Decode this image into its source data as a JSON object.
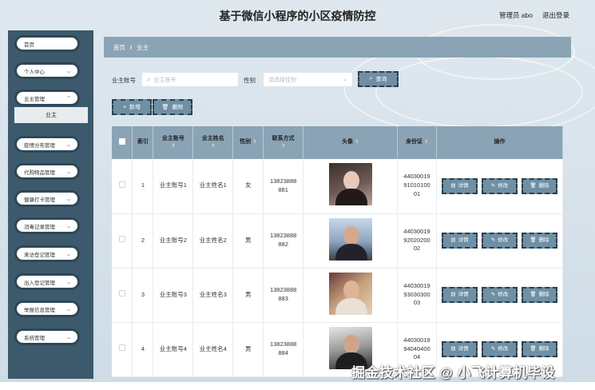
{
  "header": {
    "title": "基于微信小程序的小区疫情防控",
    "admin_label": "管理员 abo",
    "logout_label": "退出登录"
  },
  "sidebar": {
    "items": [
      {
        "label": "首页",
        "has_chevron": false
      },
      {
        "label": "个人中心",
        "has_chevron": true
      },
      {
        "label": "业主管理",
        "has_chevron": true
      },
      {
        "label": "疫情分布管理",
        "has_chevron": true
      },
      {
        "label": "代购物品管理",
        "has_chevron": true
      },
      {
        "label": "健康打卡管理",
        "has_chevron": true
      },
      {
        "label": "消毒记录管理",
        "has_chevron": true
      },
      {
        "label": "来访登记管理",
        "has_chevron": true
      },
      {
        "label": "出入登记管理",
        "has_chevron": true
      },
      {
        "label": "举报信息管理",
        "has_chevron": true
      },
      {
        "label": "系统管理",
        "has_chevron": true
      }
    ],
    "active_submenu": "业主"
  },
  "breadcrumb": {
    "home": "首页",
    "separator": "/",
    "current": "业主"
  },
  "search": {
    "account_label": "业主账号",
    "account_placeholder": "业主账号",
    "gender_label": "性别",
    "gender_placeholder": "请选择性别",
    "query_button": "查询"
  },
  "actions": {
    "add_button": "新增",
    "delete_button": "删除"
  },
  "table": {
    "columns": [
      "索引",
      "业主账号",
      "业主姓名",
      "性别",
      "联系方式",
      "头像",
      "身份证",
      "操作"
    ],
    "rows": [
      {
        "index": "1",
        "account": "业主账号1",
        "name": "业主姓名1",
        "gender": "女",
        "phone_a": "13823888",
        "phone_b": "881",
        "id_a": "44030019",
        "id_b": "91010100",
        "id_c": "01"
      },
      {
        "index": "2",
        "account": "业主账号2",
        "name": "业主姓名2",
        "gender": "男",
        "phone_a": "13823888",
        "phone_b": "882",
        "id_a": "44030019",
        "id_b": "92020200",
        "id_c": "02"
      },
      {
        "index": "3",
        "account": "业主账号3",
        "name": "业主姓名3",
        "gender": "男",
        "phone_a": "13823888",
        "phone_b": "883",
        "id_a": "44030019",
        "id_b": "93030300",
        "id_c": "03"
      },
      {
        "index": "4",
        "account": "业主账号4",
        "name": "业主姓名4",
        "gender": "男",
        "phone_a": "13823888",
        "phone_b": "884",
        "id_a": "44030019",
        "id_b": "94040400",
        "id_c": "04"
      }
    ],
    "op_labels": {
      "detail": "详情",
      "edit": "修改",
      "delete": "删除"
    }
  },
  "watermark": "掘金技术社区 @ 小飞计算机毕设",
  "colors": {
    "sidebar": "#3c5a6c",
    "header_cell": "#8aa4b6",
    "button": "#6f8fa4"
  }
}
